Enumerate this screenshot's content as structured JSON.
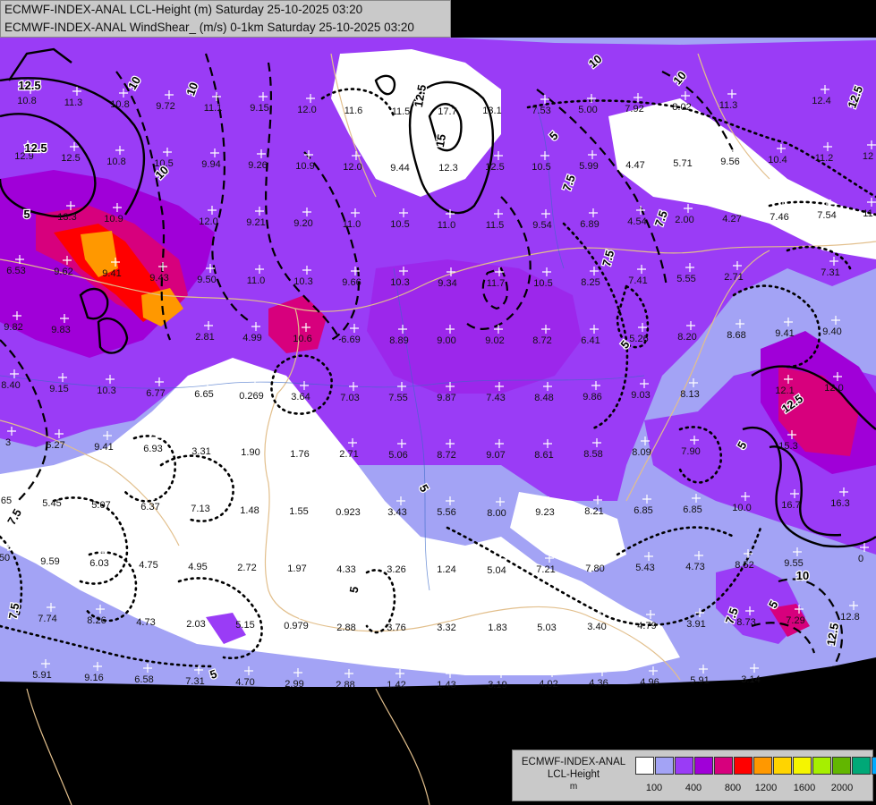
{
  "header": {
    "line1": "ECMWF-INDEX-ANAL LCL-Height (m) Saturday 25-10-2025 03:20",
    "line2": "ECMWF-INDEX-ANAL WindShear_ (m/s) 0-1km Saturday 25-10-2025 03:20"
  },
  "legend": {
    "title": "ECMWF-INDEX-ANAL",
    "subtitle": "LCL-Height",
    "unit": "m",
    "colors": [
      "#ffffff",
      "#a3a3f5",
      "#9a3cf6",
      "#a000d8",
      "#d7007d",
      "#ff0000",
      "#ff9800",
      "#ffd400",
      "#f5f500",
      "#a6ef00",
      "#62b600",
      "#00a877",
      "#00aaff"
    ],
    "ticks": [
      "100",
      "400",
      "800",
      "1200",
      "1600",
      "2000"
    ]
  },
  "map_values": [
    {
      "t": "10.8"
    },
    {
      "t": "11.3"
    },
    {
      "t": "10.8"
    },
    {
      "t": "9.72"
    },
    {
      "t": "11.1"
    },
    {
      "t": "9.15"
    },
    {
      "t": "12.0"
    },
    {
      "t": "11.6"
    },
    {
      "t": "11.5"
    },
    {
      "t": "17.7"
    },
    {
      "t": "13.1"
    },
    {
      "t": "7.53"
    },
    {
      "t": "5.00"
    },
    {
      "t": "7.92"
    },
    {
      "t": "8.02"
    },
    {
      "t": "11.3"
    },
    {
      "t": "12.4"
    },
    {
      "t": "12.9"
    },
    {
      "t": "12.5"
    },
    {
      "t": "10.8"
    },
    {
      "t": "10.5"
    },
    {
      "t": "9.94"
    },
    {
      "t": "9.26"
    },
    {
      "t": "10.9"
    },
    {
      "t": "12.0"
    },
    {
      "t": "9.44"
    },
    {
      "t": "12.3"
    },
    {
      "t": "12.5"
    },
    {
      "t": "10.5"
    },
    {
      "t": "5.99"
    },
    {
      "t": "4.47"
    },
    {
      "t": "5.71"
    },
    {
      "t": "9.56"
    },
    {
      "t": "10.4"
    },
    {
      "t": "11.2"
    },
    {
      "t": "12"
    },
    {
      "t": "13.3"
    },
    {
      "t": "10.9"
    },
    {
      "t": "12.0"
    },
    {
      "t": "9.21"
    },
    {
      "t": "9.20"
    },
    {
      "t": "11.0"
    },
    {
      "t": "10.5"
    },
    {
      "t": "11.0"
    },
    {
      "t": "11.5"
    },
    {
      "t": "9.54"
    },
    {
      "t": "6.89"
    },
    {
      "t": "4.54"
    },
    {
      "t": "2.00"
    },
    {
      "t": "4.27"
    },
    {
      "t": "7.46"
    },
    {
      "t": "7.54"
    },
    {
      "t": "11"
    },
    {
      "t": "6.53"
    },
    {
      "t": "9.62"
    },
    {
      "t": "9.41"
    },
    {
      "t": "9.43"
    },
    {
      "t": "9.50"
    },
    {
      "t": "11.0"
    },
    {
      "t": "10.3"
    },
    {
      "t": "9.66"
    },
    {
      "t": "10.3"
    },
    {
      "t": "9.34"
    },
    {
      "t": "11.7"
    },
    {
      "t": "10.5"
    },
    {
      "t": "8.25"
    },
    {
      "t": "7.41"
    },
    {
      "t": "5.55"
    },
    {
      "t": "2.71"
    },
    {
      "t": "7.31"
    },
    {
      "t": "9.82"
    },
    {
      "t": "9.83"
    },
    {
      "t": "2.81"
    },
    {
      "t": "4.99"
    },
    {
      "t": "10.6"
    },
    {
      "t": "6.69"
    },
    {
      "t": "8.89"
    },
    {
      "t": "9.00"
    },
    {
      "t": "9.02"
    },
    {
      "t": "8.72"
    },
    {
      "t": "6.41"
    },
    {
      "t": "5.26"
    },
    {
      "t": "8.20"
    },
    {
      "t": "8.68"
    },
    {
      "t": "9.41"
    },
    {
      "t": "9.40"
    },
    {
      "t": "8.40"
    },
    {
      "t": "9.15"
    },
    {
      "t": "10.3"
    },
    {
      "t": "6.77"
    },
    {
      "t": "6.65"
    },
    {
      "t": "0.269"
    },
    {
      "t": "3.64"
    },
    {
      "t": "7.03"
    },
    {
      "t": "7.55"
    },
    {
      "t": "9.87"
    },
    {
      "t": "7.43"
    },
    {
      "t": "8.48"
    },
    {
      "t": "9.86"
    },
    {
      "t": "9.03"
    },
    {
      "t": "8.13"
    },
    {
      "t": "12.1"
    },
    {
      "t": "12.0"
    },
    {
      "t": "3"
    },
    {
      "t": "6.27"
    },
    {
      "t": "9.41"
    },
    {
      "t": "6.93"
    },
    {
      "t": "3.31"
    },
    {
      "t": "1.90"
    },
    {
      "t": "1.76"
    },
    {
      "t": "2.71"
    },
    {
      "t": "5.06"
    },
    {
      "t": "8.72"
    },
    {
      "t": "9.07"
    },
    {
      "t": "8.61"
    },
    {
      "t": "8.58"
    },
    {
      "t": "8.09"
    },
    {
      "t": "7.90"
    },
    {
      "t": "15.3"
    },
    {
      "t": "65"
    },
    {
      "t": "5.45"
    },
    {
      "t": "5.07"
    },
    {
      "t": "6.37"
    },
    {
      "t": "7.13"
    },
    {
      "t": "1.48"
    },
    {
      "t": "1.55"
    },
    {
      "t": "0.923"
    },
    {
      "t": "3.43"
    },
    {
      "t": "5.56"
    },
    {
      "t": "8.00"
    },
    {
      "t": "9.23"
    },
    {
      "t": "8.21"
    },
    {
      "t": "6.85"
    },
    {
      "t": "6.85"
    },
    {
      "t": "10.0"
    },
    {
      "t": "16.7"
    },
    {
      "t": "16.3"
    },
    {
      "t": "50"
    },
    {
      "t": "9.59"
    },
    {
      "t": "6.03"
    },
    {
      "t": "4.75"
    },
    {
      "t": "4.95"
    },
    {
      "t": "2.72"
    },
    {
      "t": "1.97"
    },
    {
      "t": "4.33"
    },
    {
      "t": "3.26"
    },
    {
      "t": "1.24"
    },
    {
      "t": "5.04"
    },
    {
      "t": "7.21"
    },
    {
      "t": "7.80"
    },
    {
      "t": "5.43"
    },
    {
      "t": "4.73"
    },
    {
      "t": "8.52"
    },
    {
      "t": "9.55"
    },
    {
      "t": "0"
    },
    {
      "t": "7.74"
    },
    {
      "t": "8.26"
    },
    {
      "t": "4.73"
    },
    {
      "t": "2.03"
    },
    {
      "t": "5.15"
    },
    {
      "t": "0.979"
    },
    {
      "t": "2.88"
    },
    {
      "t": "3.76"
    },
    {
      "t": "3.32"
    },
    {
      "t": "1.83"
    },
    {
      "t": "5.03"
    },
    {
      "t": "3.40"
    },
    {
      "t": "4.79"
    },
    {
      "t": "3.91"
    },
    {
      "t": "8.73"
    },
    {
      "t": "7.29"
    },
    {
      "t": "12.8"
    },
    {
      "t": "5.91"
    },
    {
      "t": "9.16"
    },
    {
      "t": "6.58"
    },
    {
      "t": "7.31"
    },
    {
      "t": "4.70"
    },
    {
      "t": "2.99"
    },
    {
      "t": "2.88"
    },
    {
      "t": "1.42"
    },
    {
      "t": "1.43"
    },
    {
      "t": "3.19"
    },
    {
      "t": "4.02"
    },
    {
      "t": "4.36"
    },
    {
      "t": "4.96"
    },
    {
      "t": "5.91"
    },
    {
      "t": "3.14"
    }
  ],
  "contour_labels": [
    {
      "t": "12.5"
    },
    {
      "t": "10"
    },
    {
      "t": "12.5"
    },
    {
      "t": "5"
    },
    {
      "t": "10"
    },
    {
      "t": "10"
    },
    {
      "t": "12.5"
    },
    {
      "t": "15"
    },
    {
      "t": "10"
    },
    {
      "t": "12.5"
    },
    {
      "t": "10"
    },
    {
      "t": "7.5"
    },
    {
      "t": "5"
    },
    {
      "t": "7.5"
    },
    {
      "t": "7.5"
    },
    {
      "t": "5"
    },
    {
      "t": "12.5"
    },
    {
      "t": "5"
    },
    {
      "t": "5"
    },
    {
      "t": "7.5"
    },
    {
      "t": "7.5"
    },
    {
      "t": "5"
    },
    {
      "t": "10"
    },
    {
      "t": "5"
    },
    {
      "t": "7.5"
    },
    {
      "t": "12.5"
    },
    {
      "t": "5"
    }
  ]
}
